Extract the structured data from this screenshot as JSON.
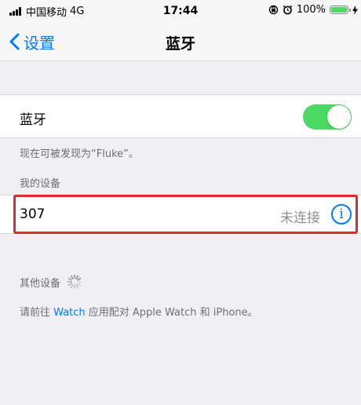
{
  "status_bar": {
    "carrier": "中国移动",
    "network": "4G",
    "time": "17:44",
    "battery_text": "100%",
    "battery_level": 1.0,
    "battery_color": "#4cd964"
  },
  "nav": {
    "back_label": "设置",
    "title": "蓝牙"
  },
  "bluetooth": {
    "label": "蓝牙",
    "enabled": true,
    "toggle_color": "#4cd964",
    "discoverable_note": "现在可被发现为“Fluke”。"
  },
  "my_devices": {
    "header": "我的设备",
    "items": [
      {
        "name": "307",
        "status": "未连接",
        "info_icon": "info-circle-icon"
      }
    ],
    "highlight_color": "#e02b2b"
  },
  "other_devices": {
    "header": "其他设备"
  },
  "pairing_note": {
    "prefix": "请前往 ",
    "link": "Watch",
    "suffix": " 应用配对 Apple Watch 和 iPhone。"
  },
  "colors": {
    "accent": "#007aff",
    "background": "#efeff4",
    "secondary_text": "#6d6d72"
  }
}
